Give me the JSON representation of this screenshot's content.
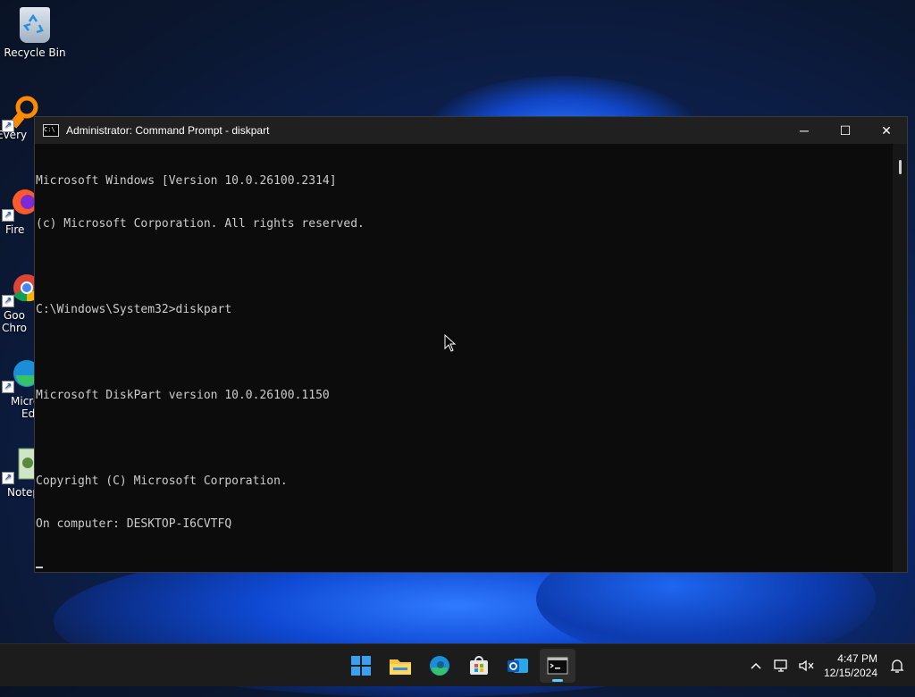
{
  "desktop": {
    "icons": [
      {
        "label": "Recycle Bin"
      },
      {
        "label": "Every"
      },
      {
        "label": "Fire"
      },
      {
        "label": "Goo"
      },
      {
        "label": "Chro"
      },
      {
        "label": "Micro"
      },
      {
        "label": "Ed"
      },
      {
        "label": "Notep"
      }
    ]
  },
  "window": {
    "title": "Administrator: Command Prompt - diskpart",
    "icon_text": "C:\\",
    "minimize": "─",
    "maximize": "☐",
    "close": "✕",
    "console_lines": [
      "Microsoft Windows [Version 10.0.26100.2314]",
      "(c) Microsoft Corporation. All rights reserved.",
      "",
      "C:\\Windows\\System32>diskpart",
      "",
      "Microsoft DiskPart version 10.0.26100.1150",
      "",
      "Copyright (C) Microsoft Corporation.",
      "On computer: DESKTOP-I6CVTFQ",
      ""
    ]
  },
  "taskbar": {
    "apps": [
      {
        "name": "start-icon"
      },
      {
        "name": "file-explorer-icon"
      },
      {
        "name": "edge-icon"
      },
      {
        "name": "store-icon"
      },
      {
        "name": "outlook-icon"
      },
      {
        "name": "terminal-icon"
      }
    ],
    "tray": {
      "time": "4:47 PM",
      "date": "12/15/2024"
    }
  },
  "colors": {
    "console_bg": "#0c0c0c",
    "console_text": "#cccccc",
    "titlebar_bg": "#202020",
    "taskbar_bg": "#1c1c1c",
    "accent": "#60cdff"
  }
}
